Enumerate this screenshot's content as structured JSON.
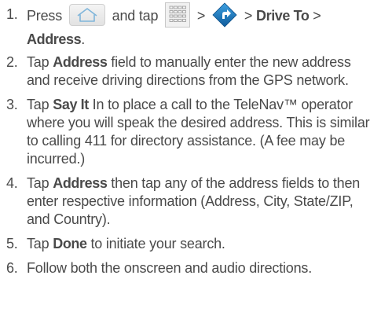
{
  "steps": [
    {
      "num": "1.",
      "press": "Press",
      "and_tap": "and tap",
      "gt1": ">",
      "gt2": ">",
      "drive_to": "Drive To",
      "gt3": ">",
      "address": "Address",
      "period": "."
    },
    {
      "num": "2.",
      "tap": "Tap",
      "bold": "Address",
      "rest": " field to manually enter the new address and receive driving directions from the GPS network."
    },
    {
      "num": "3.",
      "tap": "Tap",
      "bold": "Say It",
      "rest": " In to place a call to the TeleNav™ operator where you will speak the desired address. This is similar to calling 411 for directory assistance. (A fee may be incurred.)"
    },
    {
      "num": "4.",
      "tap": "Tap",
      "bold": "Address",
      "rest": " then tap any of the address fields to then enter respective information (Address, City, State/ZIP, and Country)."
    },
    {
      "num": "5.",
      "tap": "Tap",
      "bold": "Done",
      "rest": " to initiate your search."
    },
    {
      "num": "6.",
      "text": "Follow both the onscreen and audio directions."
    }
  ],
  "icons": {
    "home": "home-key-icon",
    "apps": "applications-grid-icon",
    "navigator": "telenav-navigator-icon"
  },
  "colors": {
    "text": "#4a4a4a",
    "home_icon_stroke": "#7fb5da",
    "navigator_blue": "#1f7fc4"
  }
}
